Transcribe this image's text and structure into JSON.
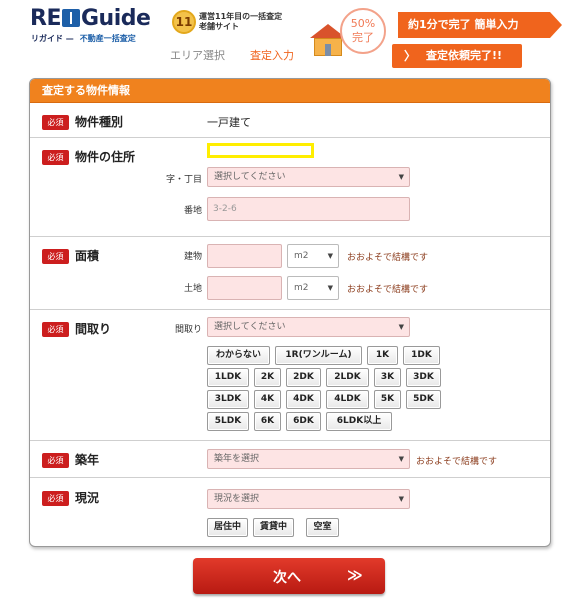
{
  "header": {
    "logo_text_a": "RE",
    "logo_text_b": "Guide",
    "logo_sub_a": "リガイド —",
    "logo_sub_b": "不動産一括査定",
    "badge_number": "11",
    "tagline_line1": "運営11年目の一括査定",
    "tagline_line2": "老舗サイト",
    "pct_value": "50%",
    "pct_label": "完了",
    "promo": "約1分で完了 簡単入力",
    "step1": "エリア選択",
    "step2": "査定入力",
    "step3": "査定依頼完了!!",
    "step3_chevron": "〉"
  },
  "form": {
    "title": "査定する物件情報",
    "required_badge": "必須",
    "property_type": {
      "label": "物件種別",
      "value": "一戸建て"
    },
    "address": {
      "label": "物件の住所",
      "chome_label": "字・丁目",
      "chome_placeholder": "選択してください",
      "banchi_label": "番地",
      "banchi_placeholder": "3-2-6"
    },
    "area": {
      "label": "面積",
      "building_label": "建物",
      "land_label": "土地",
      "unit": "m2",
      "hint": "おおよそで結構です"
    },
    "layout": {
      "label": "間取り",
      "select_label": "間取り",
      "select_placeholder": "選択してください",
      "chips": [
        "わからない",
        "1R(ワンルーム)",
        "1K",
        "1DK",
        "1LDK",
        "2K",
        "2DK",
        "2LDK",
        "3K",
        "3DK",
        "3LDK",
        "4K",
        "4DK",
        "4LDK",
        "5K",
        "5DK",
        "5LDK",
        "6K",
        "6DK",
        "6LDK以上"
      ]
    },
    "age": {
      "label": "築年",
      "select_placeholder": "築年を選択",
      "hint": "おおよそで結構です"
    },
    "status": {
      "label": "現況",
      "select_placeholder": "現況を選択",
      "chips": [
        "居住中",
        "賃貸中",
        "空室"
      ]
    }
  },
  "next_button": {
    "label": "次へ",
    "arrow": "≫"
  },
  "icons": {
    "caret": "▼"
  },
  "colors": {
    "accent_orange": "#f0821e",
    "required_red": "#cc1e1e",
    "input_pink": "#fde4e4",
    "next_red": "#d02a1c"
  }
}
